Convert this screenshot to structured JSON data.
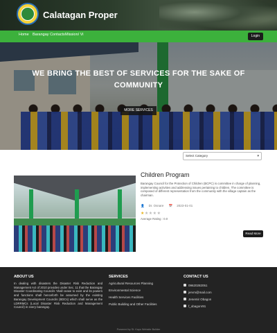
{
  "header": {
    "title": "Calatagan Proper"
  },
  "nav": {
    "items": [
      "Home",
      "Barangay Contacts",
      "Mission/ Vi"
    ],
    "login_label": "Login"
  },
  "hero": {
    "title": "WE BRING THE BEST OF SERVICES FOR THE SAKE OF COMMUNITY",
    "button_label": "MORE SERVICES"
  },
  "filter": {
    "category_placeholder": "Select Category"
  },
  "program": {
    "title": "Children Program",
    "description": "Barangay Council for the Protection of Children (BCPC) is committee in charge of planning, implementing activities and addressing issues pertaining to children. The committee is composed of different representation from the community with the village captain as the chairman.",
    "author": "Dr. Osnare",
    "date": "2023-01-01",
    "rating_label": "Average Rating : 0.0",
    "stars_filled": 1,
    "stars_total": 5,
    "read_more_label": "Read More"
  },
  "footer": {
    "about_heading": "ABOUT US",
    "about_text": "In dealing with disasters the Disaster Risk Reduction and Management Act of 2010 provides under Sec. 11 that the Barangay Disaster Coordinating Councils 'shall cease to exist and its powers and functions shall henceforth be assumed by the existing Barangay Development Councils (BDCs) which shall serve as the LDRRMCs (Local Disaster Risk Reduction and Management Council) in every barangay.",
    "services_heading": "SERVICES",
    "services": [
      "Agricultural Resources Planning",
      "Environmental Science",
      "Health Services Facilities",
      "Public Building and Other Facilities"
    ],
    "contact_heading": "CONTACT US",
    "contacts": [
      "09620282051",
      "jervm@mail.com",
      "Jenemir Obagon",
      "f_obagonr91"
    ],
    "copyright": "Powered by St. Kays Website Builder"
  },
  "colors": {
    "nav_green": "#3cb13c",
    "footer_bg": "#232323",
    "star_on": "#e8b21b"
  }
}
